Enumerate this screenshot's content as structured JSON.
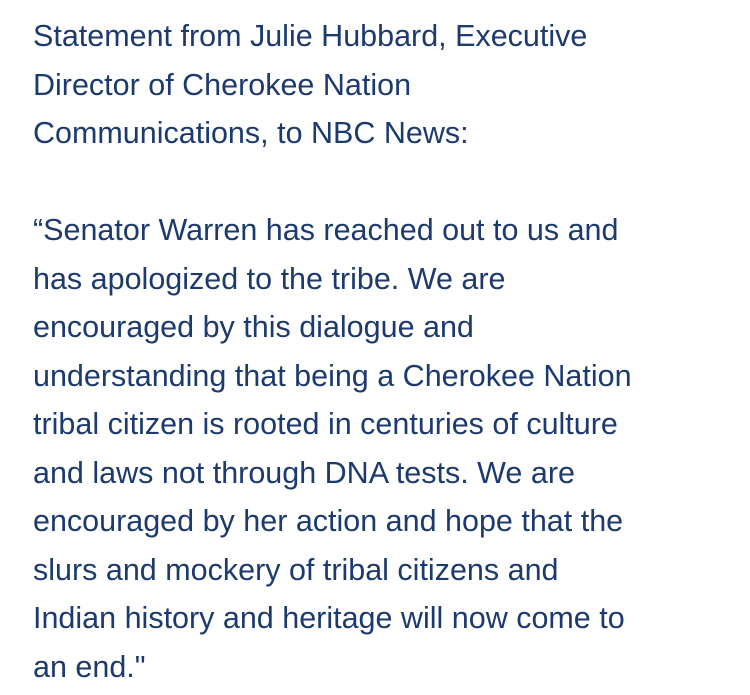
{
  "statement": {
    "header_lines": [
      "Statement from Julie Hubbard, Executive",
      "Director of Cherokee Nation",
      "Communications, to NBC News:"
    ],
    "quote_lines": [
      "“Senator Warren has reached out to us and",
      "has apologized to the tribe. We are",
      "encouraged by this dialogue and",
      "understanding that being a Cherokee Nation",
      "tribal citizen is rooted in centuries of culture",
      "and laws not through DNA tests. We are",
      "encouraged by her action and hope that the",
      "slurs and mockery of tribal citizens and",
      "Indian history and heritage will now come to",
      "an end.\""
    ]
  },
  "colors": {
    "text": "#1c3a6e",
    "background": "#ffffff"
  }
}
